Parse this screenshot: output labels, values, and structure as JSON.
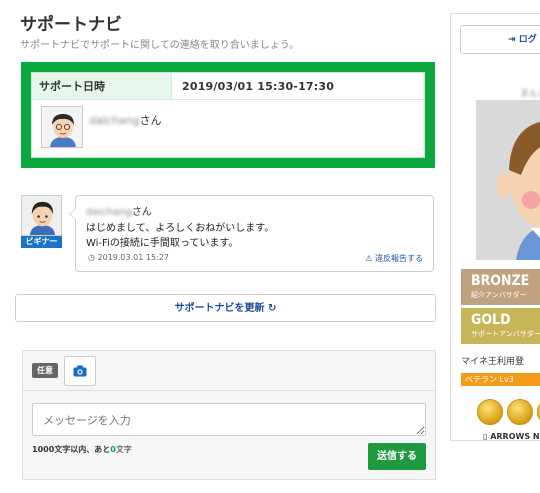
{
  "page": {
    "title": "サポートナビ",
    "subtitle": "サポートナビでサポートに関しての連絡を取り合いましょう。"
  },
  "support_box": {
    "date_label": "サポート日時",
    "date_value": "2019/03/01 15:30-17:30",
    "user_blurred": "daichang",
    "user_suffix": "さん"
  },
  "message": {
    "badge": "ビギナー",
    "author_blurred": "daichang",
    "author_suffix": "さん",
    "line1": "はじめまして、よろしくおねがいします。",
    "line2": "Wi-Fiの接続に手間取っています。",
    "timestamp": "2019.03.01 15:27",
    "report_link": "違反報告する"
  },
  "refresh_button": "サポートナビを更新",
  "compose": {
    "optional_tag": "任意",
    "placeholder": "メッセージを入力",
    "counter_prefix": "1000文字以内、あと",
    "counter_value": "0",
    "counter_suffix": "文字",
    "send_label": "送信する"
  },
  "sidebar": {
    "logout_label": "ログ",
    "user_name": "まんま",
    "bronze_title": "BRONZE",
    "bronze_sub": "紹介アンバサダー",
    "gold_title": "GOLD",
    "gold_sub": "サポートアンバサダー",
    "usage_text": "マイネ王利用登",
    "veteran": "ベテラン Lv3",
    "device": "ARROWS NX"
  },
  "colors": {
    "green": "#0aa83f",
    "send": "#1f9a3f",
    "beginner": "#1a73c7",
    "veteran": "#f59b1a",
    "bronze": "#c0a27f",
    "gold": "#c7b657"
  }
}
